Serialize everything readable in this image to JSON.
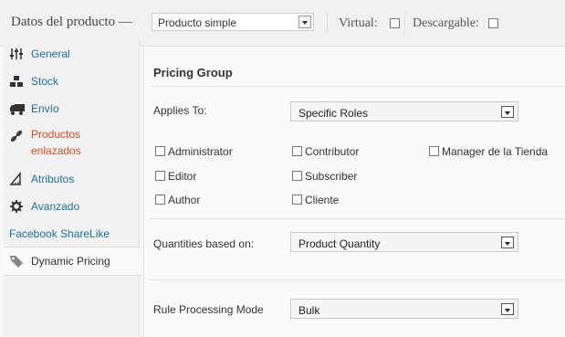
{
  "header": {
    "title": "Datos del producto —",
    "product_type": "Producto simple",
    "virtual_label": "Virtual:",
    "downloadable_label": "Descargable:"
  },
  "sidebar": {
    "items": [
      {
        "label": "General",
        "icon": "sliders-icon"
      },
      {
        "label": "Stock",
        "icon": "boxes-icon"
      },
      {
        "label": "Envío",
        "icon": "truck-icon"
      },
      {
        "label": "Productos enlazados",
        "line1": "Productos",
        "line2": "enlazados",
        "icon": "link-icon"
      },
      {
        "label": "Atributos",
        "icon": "ruler-icon"
      },
      {
        "label": "Avanzado",
        "icon": "gear-icon"
      },
      {
        "label": "Facebook ShareLike"
      },
      {
        "label": "Dynamic Pricing",
        "icon": "tag-icon"
      }
    ]
  },
  "main": {
    "group_title": "Pricing Group",
    "applies_to_label": "Applies To:",
    "applies_to_value": "Specific Roles",
    "roles": [
      "Administrator",
      "Contributor",
      "Manager de la Tienda",
      "Editor",
      "Subscriber",
      "Author",
      "Cliente"
    ],
    "quantities_label": "Quantities based on:",
    "quantities_value": "Product Quantity",
    "rule_mode_label": "Rule Processing Mode",
    "rule_mode_value": "Bulk"
  },
  "colors": {
    "link": "#2170a0",
    "link_red": "#d54e21"
  }
}
